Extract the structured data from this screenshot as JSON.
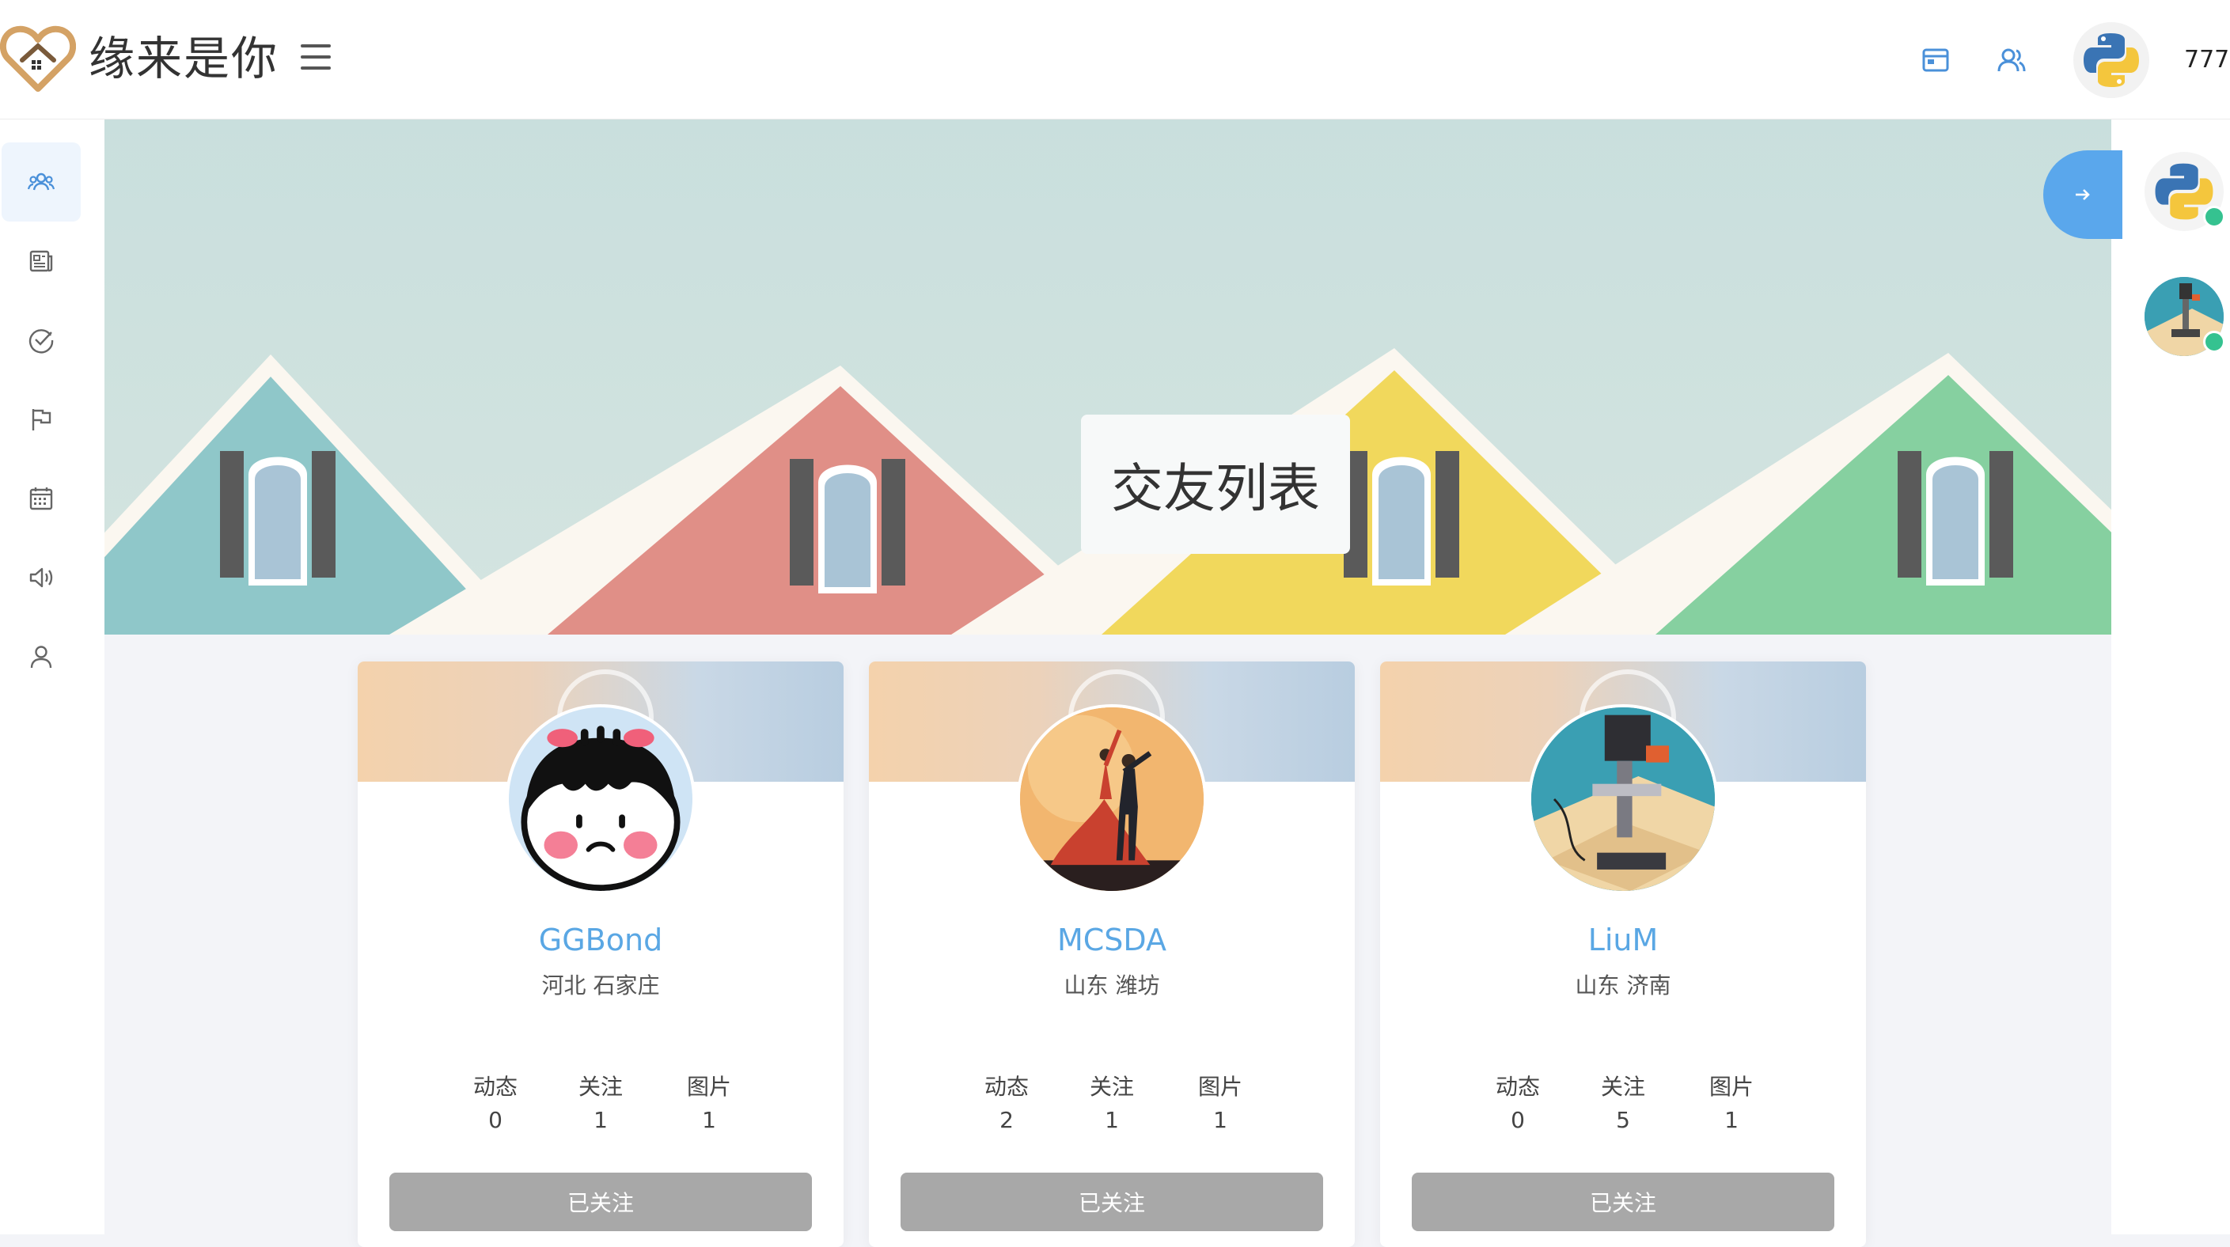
{
  "brand": {
    "name": "缘来是你",
    "logo_icon": "heart-house-logo"
  },
  "header": {
    "menu_icon": "hamburger-icon",
    "icons": [
      "browser-window-icon",
      "users-icon"
    ],
    "username": "777",
    "avatar_icon": "python-logo"
  },
  "sidebar": {
    "items": [
      {
        "icon": "friends-icon",
        "active": true
      },
      {
        "icon": "news-icon",
        "active": false
      },
      {
        "icon": "check-circle-icon",
        "active": false
      },
      {
        "icon": "flag-icon",
        "active": false
      },
      {
        "icon": "calendar-icon",
        "active": false
      },
      {
        "icon": "speaker-icon",
        "active": false
      },
      {
        "icon": "user-icon",
        "active": false
      }
    ]
  },
  "banner": {
    "title": "交友列表"
  },
  "right_rail": {
    "expand_icon": "arrow-right-icon",
    "users": [
      {
        "avatar": "python-logo",
        "online": true
      },
      {
        "avatar": "drill-press-avatar",
        "online": true
      }
    ]
  },
  "cards": [
    {
      "name": "GGBond",
      "location": "河北 石家庄",
      "avatar": "cartoon-girl-avatar",
      "stats": [
        {
          "label": "动态",
          "value": "0"
        },
        {
          "label": "关注",
          "value": "1"
        },
        {
          "label": "图片",
          "value": "1"
        }
      ],
      "button": "已关注"
    },
    {
      "name": "MCSDA",
      "location": "山东 潍坊",
      "avatar": "dancers-avatar",
      "stats": [
        {
          "label": "动态",
          "value": "2"
        },
        {
          "label": "关注",
          "value": "1"
        },
        {
          "label": "图片",
          "value": "1"
        }
      ],
      "button": "已关注"
    },
    {
      "name": "LiuM",
      "location": "山东 济南",
      "avatar": "drill-press-avatar",
      "stats": [
        {
          "label": "动态",
          "value": "0"
        },
        {
          "label": "关注",
          "value": "5"
        },
        {
          "label": "图片",
          "value": "1"
        }
      ],
      "button": "已关注"
    }
  ],
  "colors": {
    "accent": "#5aa7e4",
    "button_gray": "#a8a8a8",
    "online": "#35c290",
    "logo": "#d4a265"
  }
}
